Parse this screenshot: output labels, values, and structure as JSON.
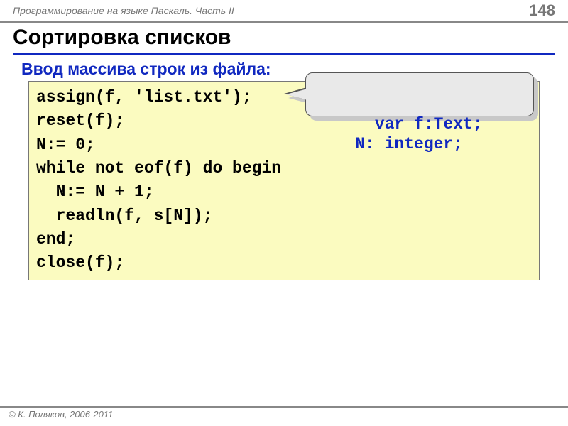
{
  "header": {
    "course": "Программирование на языке Паскаль. Часть II",
    "page": "148"
  },
  "title": "Сортировка списков",
  "subtitle": "Ввод массива строк из файла:",
  "code": "assign(f, 'list.txt');\nreset(f);\nN:= 0;\nwhile not eof(f) do begin\n  N:= N + 1;\n  readln(f, s[N]);\nend;\nclose(f);",
  "callout": "var f:Text;\n    N: integer;",
  "footer": "© К. Поляков, 2006-2011"
}
